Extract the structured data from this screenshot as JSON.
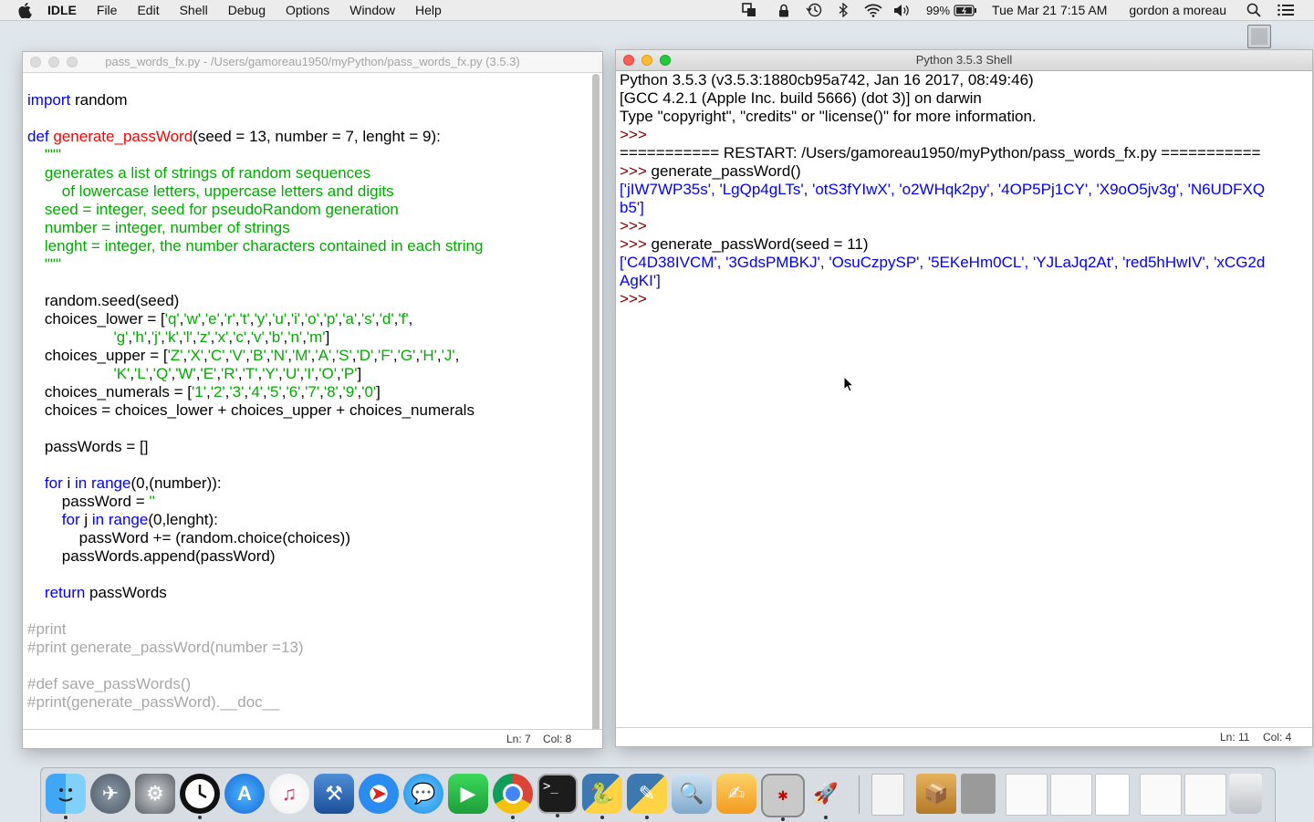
{
  "menubar": {
    "app_name": "IDLE",
    "menus": [
      "File",
      "Edit",
      "Shell",
      "Debug",
      "Options",
      "Window",
      "Help"
    ],
    "battery": "99%",
    "datetime": "Tue Mar 21  7:15 AM",
    "user": "gordon a moreau",
    "status_icons": [
      "screen-mirror-icon",
      "lock-icon",
      "time-machine-icon",
      "bluetooth-icon",
      "wifi-icon",
      "volume-icon",
      "battery-icon",
      "spotlight-icon",
      "notification-center-icon"
    ]
  },
  "editor": {
    "title": "pass_words_fx.py - /Users/gamoreau1950/myPython/pass_words_fx.py (3.5.3)",
    "lines": [
      "",
      "import random",
      "",
      "def generate_passWord(seed = 13, number = 7, lenght = 9):",
      "    \"\"\"",
      "    generates a list of strings of random sequences",
      "        of lowercase letters, uppercase letters and digits",
      "    seed = integer, seed for pseudoRandom generation",
      "    number = integer, number of strings",
      "    lenght = integer, the number characters contained in each string",
      "    \"\"\"",
      "",
      "    random.seed(seed)",
      "    choices_lower = ['q','w','e','r','t','y','u','i','o','p','a','s','d','f',",
      "                    'g','h','j','k','l','z','x','c','v','b','n','m']",
      "    choices_upper = ['Z','X','C','V','B','N','M','A','S','D','F','G','H','J',",
      "                    'K','L','Q','W','E','R','T','Y','U','I','O','P']",
      "    choices_numerals = ['1','2','3','4','5','6','7','8','9','0']",
      "    choices = choices_lower + choices_upper + choices_numerals",
      "",
      "    passWords = []",
      "",
      "    for i in range(0,(number)):",
      "        passWord = ''",
      "        for j in range(0,lenght):",
      "            passWord += (random.choice(choices))",
      "        passWords.append(passWord)",
      "",
      "    return passWords",
      "",
      "#print",
      "#print generate_passWord(number =13)",
      "",
      "#def save_passWords()",
      "#print(generate_passWord).__doc__"
    ],
    "status": {
      "line": "Ln: 7",
      "col": "Col: 8"
    }
  },
  "shell": {
    "title": "Python 3.5.3 Shell",
    "lines": [
      {
        "t": "Python 3.5.3 (v3.5.3:1880cb95a742, Jan 16 2017, 08:49:46)",
        "k": "text"
      },
      {
        "t": "[GCC 4.2.1 (Apple Inc. build 5666) (dot 3)] on darwin",
        "k": "text"
      },
      {
        "t": "Type \"copyright\", \"credits\" or \"license()\" for more information.",
        "k": "text"
      },
      {
        "t": ">>> ",
        "k": "prompt"
      },
      {
        "t": "=========== RESTART: /Users/gamoreau1950/myPython/pass_words_fx.py ===========",
        "k": "text"
      },
      {
        "t": ">>> ",
        "k": "prompt",
        "cmd": "generate_passWord()"
      },
      {
        "t": "['jIW7WP35s', 'LgQp4gLTs', 'otS3fYIwX', 'o2WHqk2py', '4OP5Pj1CY', 'X9oO5jv3g', 'N6UDFXQ",
        "k": "out"
      },
      {
        "t": "b5']",
        "k": "out"
      },
      {
        "t": ">>> ",
        "k": "prompt"
      },
      {
        "t": ">>> ",
        "k": "prompt",
        "cmd": "generate_passWord(seed = 11)"
      },
      {
        "t": "['C4D38IVCM', '3GdsPMBKJ', 'OsuCzpySP', '5EKeHm0CL', 'YJLaJq2At', 'red5hHwIV', 'xCG2d",
        "k": "out"
      },
      {
        "t": "AgKI']",
        "k": "out"
      },
      {
        "t": ">>> ",
        "k": "prompt"
      }
    ],
    "status": {
      "line": "Ln: 11",
      "col": "Col: 4"
    }
  },
  "dock": {
    "apps": [
      "finder-icon",
      "launchpad-icon",
      "system-preferences-icon",
      "clock-icon",
      "app-store-icon",
      "itunes-icon",
      "xcode-icon",
      "safari-icon",
      "messages-icon",
      "facetime-icon",
      "chrome-icon",
      "terminal-icon",
      "python-launcher-icon",
      "idle-icon",
      "preview-icon",
      "pages-icon",
      "minesweeper-icon",
      "rocket-icon"
    ],
    "docs": [
      "document-icon",
      "package-icon",
      "calculator-icon",
      "screenshot-icon",
      "screenshot-icon",
      "document-icon",
      "screenshot-icon",
      "screenshot-icon",
      "trash-icon"
    ]
  }
}
